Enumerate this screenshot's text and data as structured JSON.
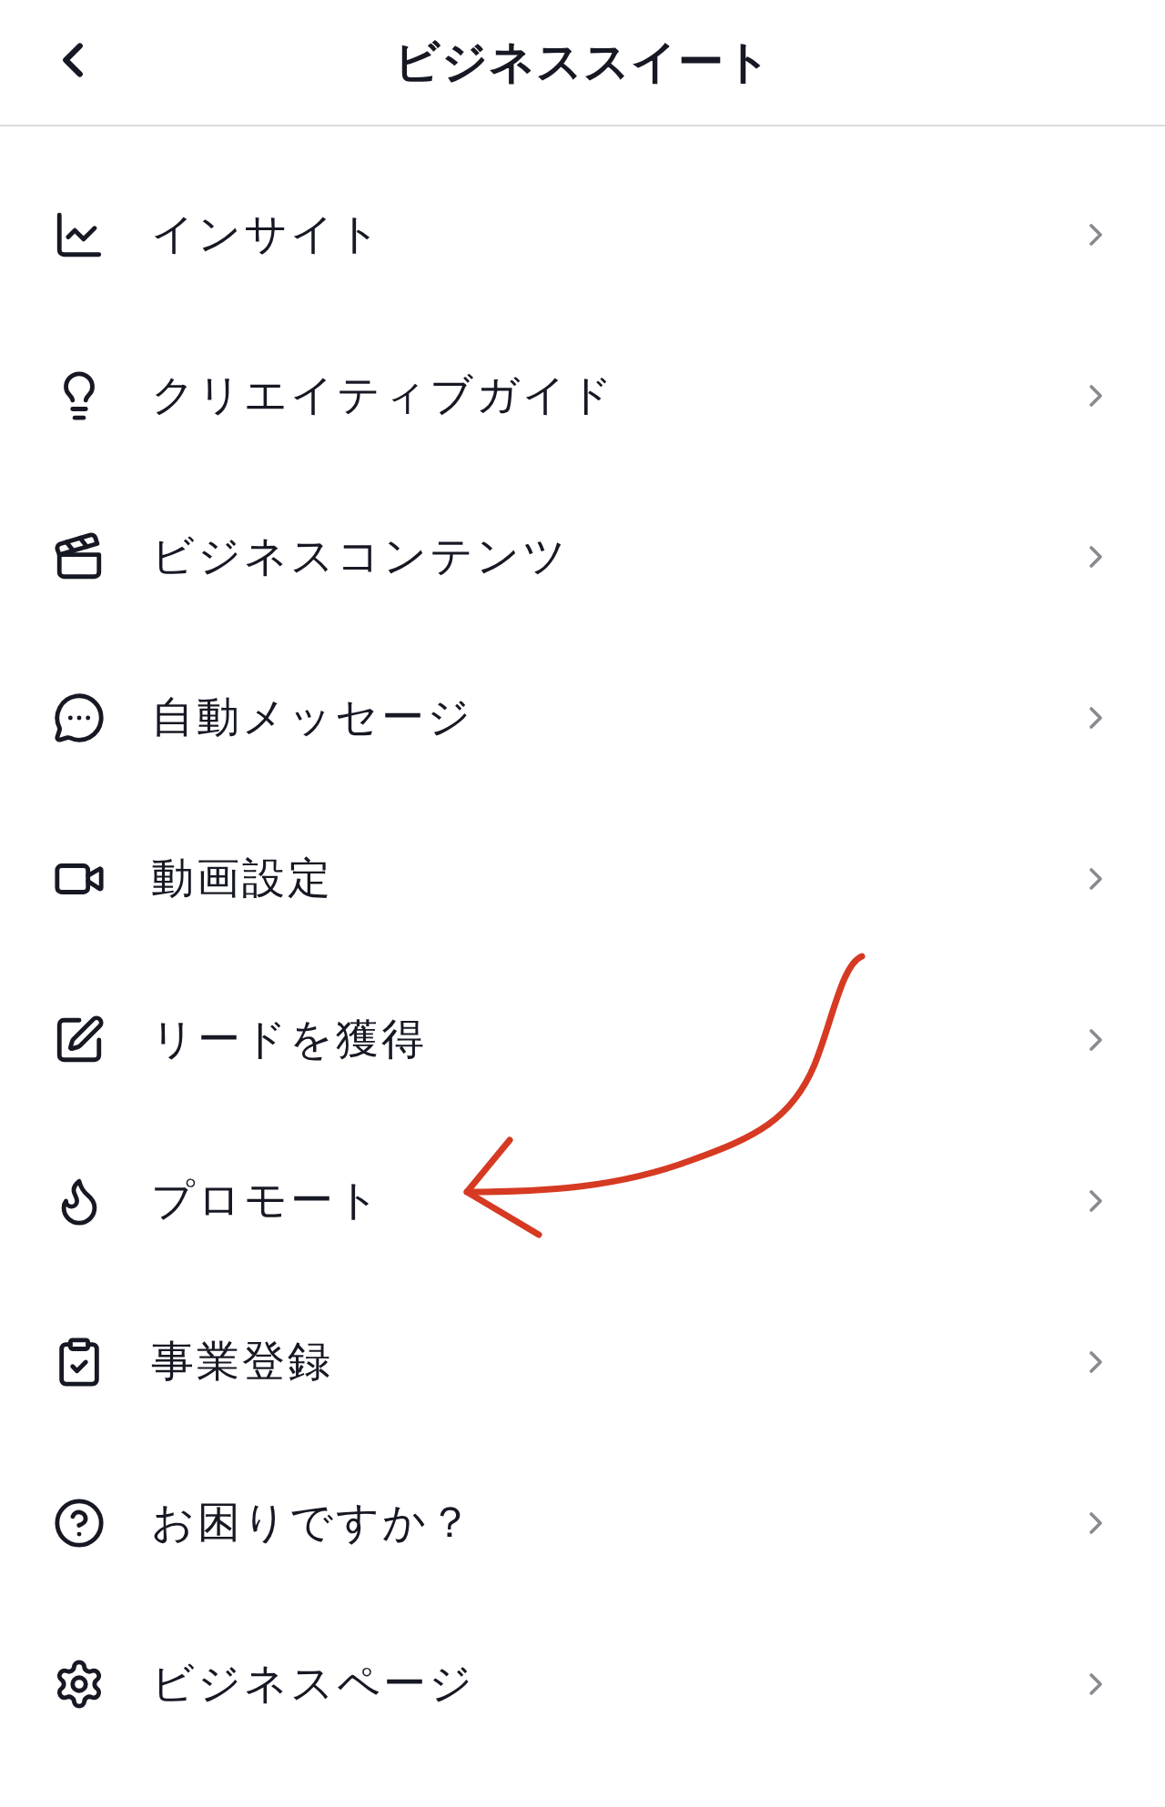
{
  "header": {
    "title": "ビジネススイート"
  },
  "menu_items": [
    {
      "label": "インサイト"
    },
    {
      "label": "クリエイティブガイド"
    },
    {
      "label": "ビジネスコンテンツ"
    },
    {
      "label": "自動メッセージ"
    },
    {
      "label": "動画設定"
    },
    {
      "label": "リードを獲得"
    },
    {
      "label": "プロモート"
    },
    {
      "label": "事業登録"
    },
    {
      "label": "お困りですか？"
    },
    {
      "label": "ビジネスページ"
    }
  ]
}
